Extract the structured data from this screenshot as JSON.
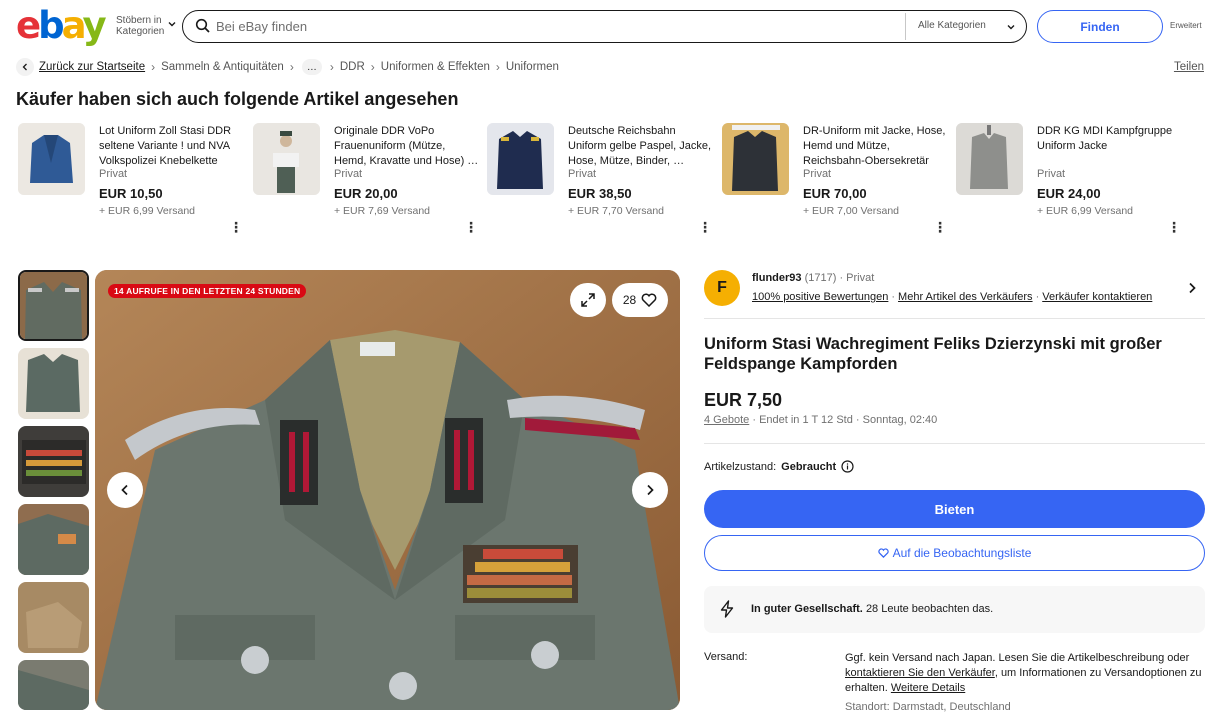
{
  "header": {
    "logo": [
      "e",
      "b",
      "a",
      "y"
    ],
    "browse_line1": "Stöbern in",
    "browse_line2": "Kategorien",
    "search_placeholder": "Bei eBay finden",
    "category_select": "Alle Kategorien",
    "find_button": "Finden",
    "advanced": "Erweitert"
  },
  "breadcrumb": {
    "back": "Zurück zur Startseite",
    "items": [
      "Sammeln & Antiquitäten",
      "…",
      "DDR",
      "Uniformen & Effekten",
      "Uniformen"
    ],
    "share": "Teilen"
  },
  "recommendations": {
    "title": "Käufer haben sich auch folgende Artikel angesehen",
    "items": [
      {
        "title": "Lot Uniform Zoll Stasi DDR seltene Variante ! und NVA Volkspolizei Knebelkette",
        "seller": "Privat",
        "price": "EUR 10,50",
        "shipping": "+ EUR 6,99 Versand"
      },
      {
        "title": "Originale DDR VoPo Frauenuniform (Mütze, Hemd, Kravatte und Hose) …",
        "seller": "Privat",
        "price": "EUR 20,00",
        "shipping": "+ EUR 7,69 Versand"
      },
      {
        "title": "Deutsche Reichsbahn Uniform gelbe Paspel, Jacke, Hose, Mütze, Binder, …",
        "seller": "Privat",
        "price": "EUR 38,50",
        "shipping": "+ EUR 7,70 Versand"
      },
      {
        "title": "DR-Uniform mit Jacke, Hose, Hemd und Mütze, Reichsbahn-Obersekretär",
        "seller": "Privat",
        "price": "EUR 70,00",
        "shipping": "+ EUR 7,00 Versand"
      },
      {
        "title": "DDR KG MDI Kampfgruppe Uniform Jacke",
        "seller": "Privat",
        "price": "EUR 24,00",
        "shipping": "+ EUR 6,99 Versand"
      }
    ]
  },
  "gallery": {
    "views_badge": "14 AUFRUFE IN DEN LETZTEN 24 STUNDEN",
    "watch_count": "28"
  },
  "seller": {
    "avatar_letter": "F",
    "name": "flunder93",
    "score": "(1717)",
    "type": "Privat",
    "feedback": "100% positive Bewertungen",
    "more_items": "Mehr Artikel des Verkäufers",
    "contact": "Verkäufer kontaktieren"
  },
  "item": {
    "title": "Uniform Stasi Wachregiment Feliks Dzierzynski mit großer Feldspange Kampforden",
    "price": "EUR 7,50",
    "bids": "4 Gebote",
    "ends": "Endet in 1 T 12 Std",
    "end_date": "Sonntag, 02:40",
    "condition_label": "Artikelzustand:",
    "condition_value": "Gebraucht",
    "bid_button": "Bieten",
    "watchlist_button": "Auf die Beobachtungsliste",
    "social_bold": "In guter Gesellschaft.",
    "social_rest": "28 Leute beobachten das.",
    "shipping_label": "Versand:",
    "shipping_text1": "Ggf. kein Versand nach Japan. Lesen Sie die Artikelbeschreibung oder",
    "shipping_link1": "kontaktieren Sie den Verkäufer",
    "shipping_text2": ", um Informationen zu Versandoptionen zu erhalten.",
    "shipping_link2": "Weitere Details",
    "location": "Standort: Darmstadt, Deutschland"
  }
}
